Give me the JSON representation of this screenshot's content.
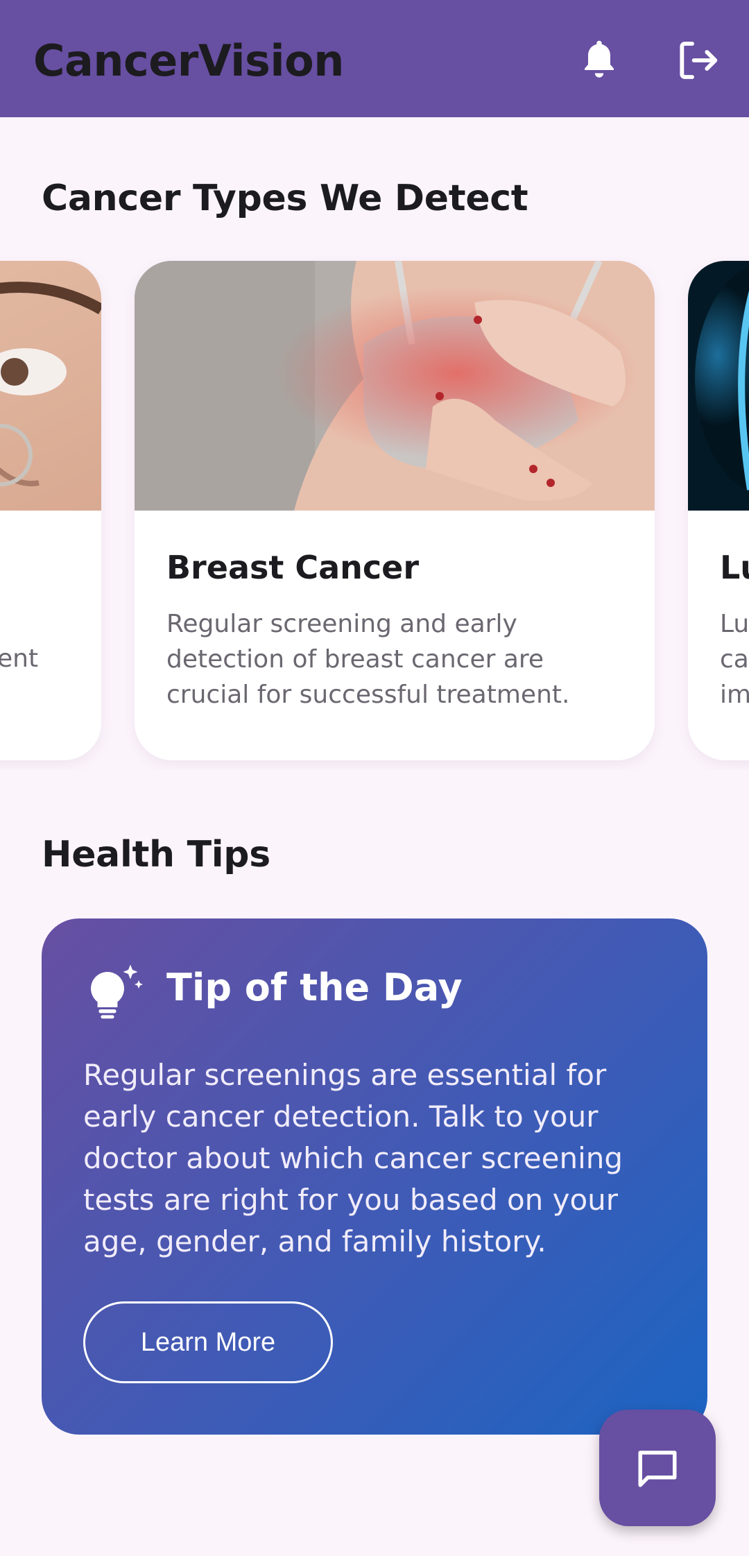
{
  "app_bar": {
    "title": "CancerVision",
    "background": "#674fa2",
    "actions": [
      {
        "icon": "notifications-bell-icon"
      },
      {
        "icon": "logout-icon"
      }
    ]
  },
  "cancer_types": {
    "section_title": "Cancer Types We Detect",
    "cards": [
      {
        "title": "",
        "description": "ent",
        "image": "face-closeup-photo"
      },
      {
        "title": "Breast Cancer",
        "description": "Regular screening and early detection of breast cancer are crucial for successful treatment.",
        "image": "breast-exam-photo"
      },
      {
        "title": "Lu",
        "description": "Lu ca im",
        "image": "lung-scan-photo"
      }
    ]
  },
  "health_tips": {
    "section_title": "Health Tips",
    "tip": {
      "icon": "lightbulb-sparkle-icon",
      "heading": "Tip of the Day",
      "text": "Regular screenings are essential for early cancer detection. Talk to your doctor about which cancer screening tests are right for you based on your age, gender, and family history.",
      "button_label": "Learn More",
      "gradient": [
        "#674fa2",
        "#1c64c2"
      ]
    }
  },
  "fab": {
    "icon": "chat-icon",
    "background": "#674fa2"
  }
}
